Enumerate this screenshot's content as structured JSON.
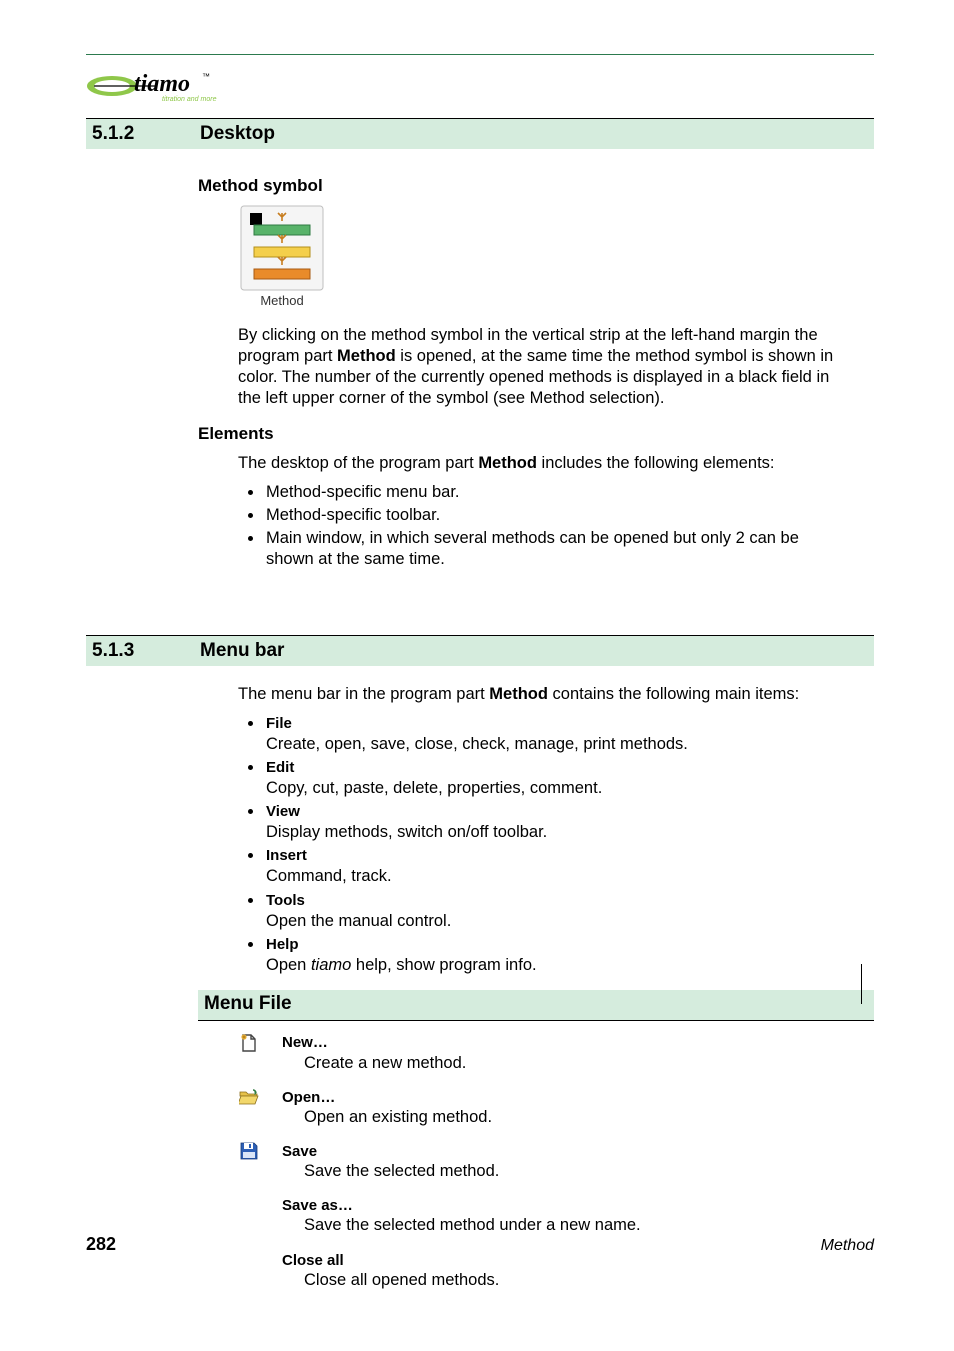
{
  "logo": {
    "brand": "tiamo",
    "tagline": "titration and more",
    "tm": "™"
  },
  "section_512": {
    "number": "5.1.2",
    "title": "Desktop",
    "method_symbol_heading": "Method symbol",
    "method_symbol_caption": "Method",
    "method_symbol_para_pre": "By clicking on the method symbol in the vertical strip at the left-hand margin the program part ",
    "method_symbol_para_bold": "Method",
    "method_symbol_para_post": " is opened, at the same time the method symbol is shown in color. The number of the currently opened methods is displayed in a black field in the left upper corner of the symbol (see Method selection).",
    "elements_heading": "Elements",
    "elements_intro_pre": "The desktop of the program part ",
    "elements_intro_bold": "Method",
    "elements_intro_post": " includes the following elements:",
    "elements_items": [
      "Method-specific menu bar.",
      "Method-specific toolbar.",
      "Main window, in which several methods can be opened but only 2 can be shown at the same time."
    ]
  },
  "section_513": {
    "number": "5.1.3",
    "title": "Menu bar",
    "intro_pre": "The menu bar in the program part ",
    "intro_bold": "Method",
    "intro_post": " contains the following main items:",
    "menus": [
      {
        "label": "File",
        "desc": "Create, open, save, close, check, manage, print methods."
      },
      {
        "label": "Edit",
        "desc": "Copy, cut, paste, delete, properties, comment."
      },
      {
        "label": "View",
        "desc": "Display methods, switch on/off toolbar."
      },
      {
        "label": "Insert",
        "desc": "Command, track."
      },
      {
        "label": "Tools",
        "desc": "Open the manual control."
      },
      {
        "label": "Help",
        "desc_pre": "Open ",
        "desc_italic": "tiamo",
        "desc_post": " help, show program info."
      }
    ],
    "menu_file_heading": "Menu File",
    "file_items": [
      {
        "icon": "new",
        "label": "New…",
        "desc": "Create a new method."
      },
      {
        "icon": "open",
        "label": "Open…",
        "desc": "Open an existing method."
      },
      {
        "icon": "save",
        "label": "Save",
        "desc": "Save the selected method."
      },
      {
        "icon": "",
        "label": "Save as…",
        "desc": "Save the selected method under a new name."
      },
      {
        "icon": "",
        "label": "Close all",
        "desc": "Close all opened methods."
      }
    ]
  },
  "footer": {
    "page": "282",
    "part": "Method"
  }
}
